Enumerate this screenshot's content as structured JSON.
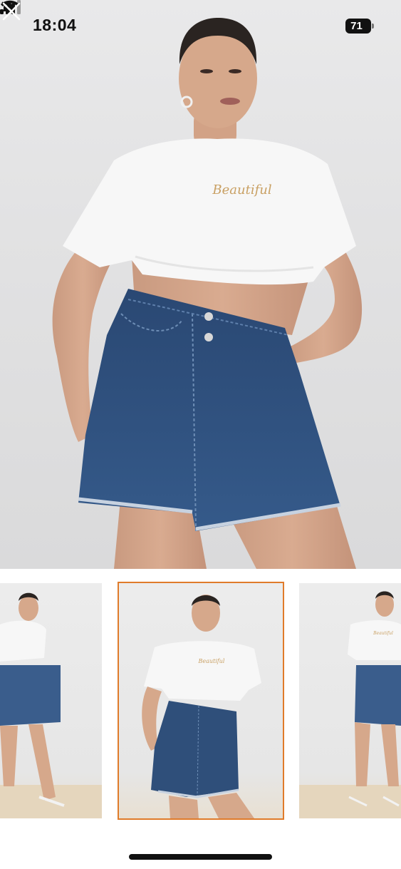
{
  "status_bar": {
    "time": "18:04",
    "battery": "71",
    "icons": [
      "bell-muted-icon",
      "cellular-signal-icon",
      "wifi-icon",
      "battery-icon"
    ]
  },
  "viewer": {
    "close_icon": "close-icon",
    "main_image_alt": "Model wearing white cropped t-shirt and dark denim wrap skort",
    "tshirt_print": "Beautiful"
  },
  "thumbnails": [
    {
      "name": "thumbnail-1",
      "selected": false
    },
    {
      "name": "thumbnail-2",
      "selected": true
    },
    {
      "name": "thumbnail-3",
      "selected": false
    }
  ],
  "colors": {
    "accent_selected": "#e07b2a",
    "denim": "#2f4f7a",
    "shirt": "#f7f7f7",
    "background": "#e5e5e6"
  }
}
